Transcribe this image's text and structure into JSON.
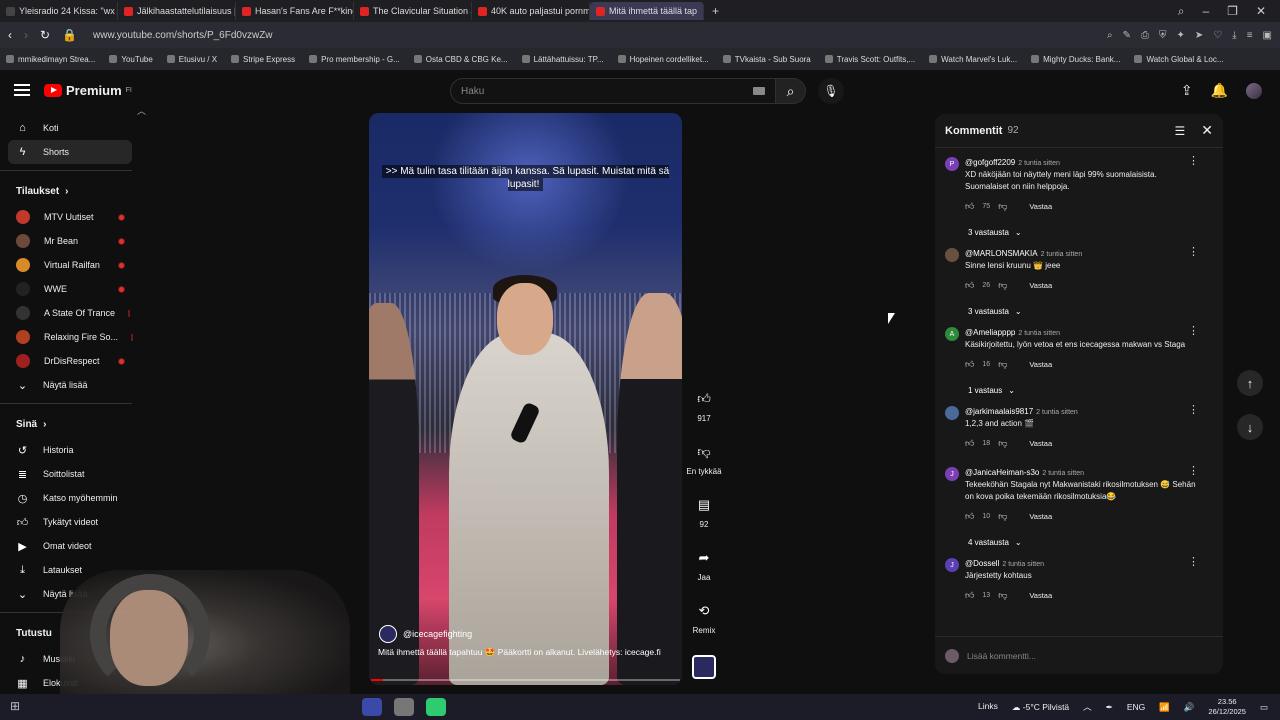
{
  "browser": {
    "tabs": [
      {
        "label": "Yleisradio 24 Kissa: \"wx A.M",
        "active": false
      },
      {
        "label": "Jälkihaastattelutilaisuus | !",
        "active": false
      },
      {
        "label": "Hasan's Fans Are F**king",
        "active": false
      },
      {
        "label": "The Clavicular Situation Ja",
        "active": false
      },
      {
        "label": "40K auto paljastui pornmi",
        "active": false
      },
      {
        "label": "Mitä ihmettä täällä tap",
        "active": true
      }
    ],
    "new_tab": "+",
    "url": "www.youtube.com/shorts/P_6Fd0vzwZw",
    "bookmarks": [
      "mmikedimayn Strea...",
      "YouTube",
      "Etusivu / X",
      "Stripe Express",
      "Pro membership - G...",
      "Osta CBD & CBG Ke...",
      "Lättähattuissu: TP...",
      "Hopeinen cordelliket...",
      "TVkaista - Sub Suora",
      "Travis Scott: Outfits,...",
      "Watch Marvel's Luk...",
      "Mighty Ducks: Bank...",
      "Watch Global & Loc..."
    ]
  },
  "header": {
    "logo_text": "Premium",
    "logo_sup": "FI",
    "search_placeholder": "Haku"
  },
  "sidebar": {
    "main": [
      {
        "label": "Koti",
        "icon": "home-icon"
      },
      {
        "label": "Shorts",
        "icon": "shorts-icon",
        "active": true
      }
    ],
    "subs_heading": "Tilaukset",
    "subscriptions": [
      {
        "label": "MTV Uutiset",
        "color": "#c0392b"
      },
      {
        "label": "Mr Bean",
        "color": "#6b4a3a"
      },
      {
        "label": "Virtual Railfan",
        "color": "#d68a2a"
      },
      {
        "label": "WWE",
        "color": "#222222"
      },
      {
        "label": "A State Of Trance",
        "color": "#333333"
      },
      {
        "label": "Relaxing Fire So...",
        "color": "#b04020"
      },
      {
        "label": "DrDisRespect",
        "color": "#a02020"
      }
    ],
    "show_more": "Näytä lisää",
    "you_heading": "Sinä",
    "you_items": [
      {
        "label": "Historia",
        "icon": "history-icon"
      },
      {
        "label": "Soittolistat",
        "icon": "playlist-icon"
      },
      {
        "label": "Katso myöhemmin",
        "icon": "watch-later-icon"
      },
      {
        "label": "Tykätyt videot",
        "icon": "liked-icon"
      },
      {
        "label": "Omat videot",
        "icon": "my-videos-icon"
      },
      {
        "label": "Lataukset",
        "icon": "downloads-icon"
      },
      {
        "label": "Näytä lisää",
        "icon": "chevron-down-icon"
      }
    ],
    "explore_heading": "Tutustu",
    "explore_items": [
      "Musiikki",
      "Elokuvat"
    ]
  },
  "video": {
    "subtitle": ">> Mä tulin tasa tilitään äijän kanssa. Sä lupasit. Muistat mitä sä lupasit!",
    "channel": "@icecagefighting",
    "title": "Mitä ihmettä täällä tapahtuu 🤩 Pääkortti on alkanut. Livelähetys: icecage.fi",
    "progress": 0.04
  },
  "actions": {
    "likes": "917",
    "dislike_label": "En tykkää",
    "comments": "92",
    "share_label": "Jaa",
    "remix_label": "Remix"
  },
  "comments": {
    "title": "Kommentit",
    "count": "92",
    "add_placeholder": "Lisää kommentti...",
    "reply_label": "Vastaa",
    "items": [
      {
        "user": "@gofgoff2209",
        "time": "2 tuntia sitten",
        "avatar": "P",
        "avatar_color": "#7b3fb5",
        "text": "XD näköjään toi näyttely meni läpi 99% suomalaisista. Suomalaiset on niin helppoja.",
        "likes": "75",
        "replies": "3 vastausta"
      },
      {
        "user": "@MARLONSMAKIA",
        "time": "2 tuntia sitten",
        "avatar": "",
        "avatar_color": "#6a5040",
        "text": "Sinne lensi kruunu 👑 jeee",
        "likes": "26",
        "replies": "3 vastausta"
      },
      {
        "user": "@Ameliapppp",
        "time": "2 tuntia sitten",
        "avatar": "A",
        "avatar_color": "#2e8b3a",
        "text": "Käsikirjoitettu, lyön vetoa et ens icecagessa makwan vs Staga",
        "likes": "16",
        "replies": "1 vastaus"
      },
      {
        "user": "@jarkimaalais9817",
        "time": "2 tuntia sitten",
        "avatar": "",
        "avatar_color": "#4a6a9a",
        "text": "1,2,3 and action 🎬",
        "likes": "18",
        "replies": ""
      },
      {
        "user": "@JanicaHeiman-s3o",
        "time": "2 tuntia sitten",
        "avatar": "J",
        "avatar_color": "#7b3fb5",
        "text": "Tekeeköhän Stagala nyt Makwanistaki rikosilmotuksen 😅 Sehän on kova poika tekemään rikosilmotuksia😂",
        "likes": "10",
        "replies": "4 vastausta"
      },
      {
        "user": "@Dossell",
        "time": "2 tuntia sitten",
        "avatar": "J",
        "avatar_color": "#5a3fb5",
        "text": "Järjestetty kohtaus",
        "likes": "13",
        "replies": ""
      }
    ]
  },
  "taskbar": {
    "links": "Links",
    "weather": "-5°C Pilvistä",
    "lang": "ENG",
    "time": "23.56",
    "date": "26/12/2025"
  }
}
